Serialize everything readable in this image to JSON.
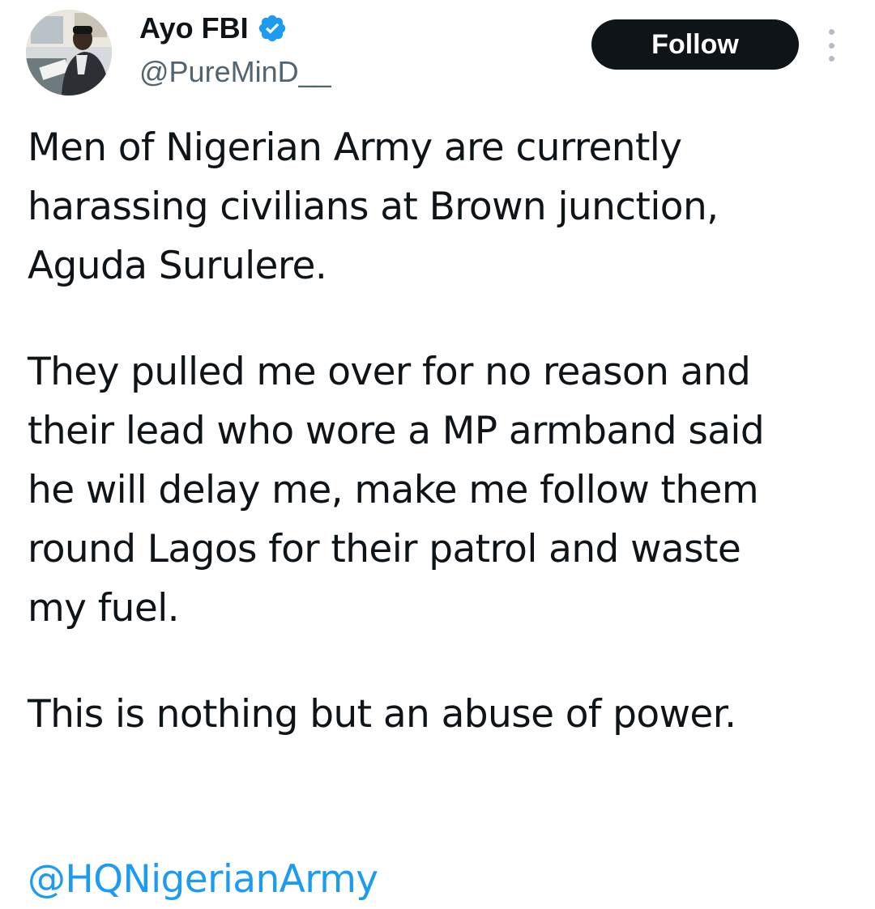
{
  "user": {
    "display_name": "Ayo FBI",
    "handle": "@PureMinD__",
    "verified_icon": "verified-badge-icon",
    "avatar_icon": "avatar"
  },
  "actions": {
    "follow_label": "Follow",
    "more_icon": "more-vertical-icon"
  },
  "tweet": {
    "paragraph_1": "Men of Nigerian Army are currently\nharassing civilians at Brown junction,\nAguda Surulere.",
    "paragraph_2": "They pulled me over for no reason and\ntheir lead who wore a MP armband said\nhe will delay me, make me follow them\nround Lagos for their patrol and waste\nmy fuel.",
    "paragraph_3": "This is nothing but an abuse of power.",
    "mention": "@HQNigerianArmy"
  },
  "colors": {
    "text": "#0f1419",
    "secondary": "#536471",
    "link": "#1d9bf0",
    "verified": "#1d9bf0",
    "follow_bg": "#0f1419"
  }
}
